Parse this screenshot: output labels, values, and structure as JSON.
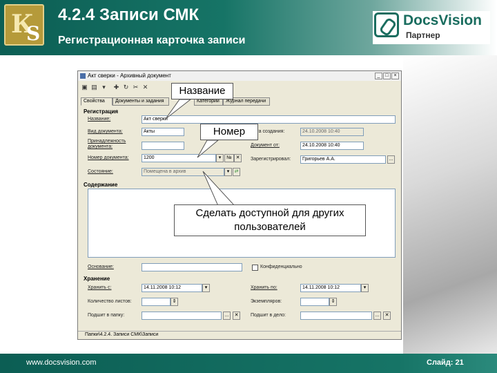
{
  "slide": {
    "title": "4.2.4  Записи СМК",
    "subtitle": "Регистрационная карточка записи",
    "brand_name": "DocsVision",
    "brand_sub": "Партнер",
    "footer_url": "www.docsvision.com",
    "slide_number": "Слайд: 21"
  },
  "window": {
    "title": "Акт сверки - Архивный документ",
    "tabs": [
      "Свойства",
      "Документы и задания",
      "Категории",
      "Журнал передачи"
    ],
    "sections": {
      "registration": "Регистрация",
      "content": "Содержание",
      "storage": "Хранение"
    },
    "fields": {
      "name_label": "Название:",
      "name_value": "Акт сверки",
      "doc_type_label": "Вид документа:",
      "doc_type_value": "Акты",
      "belongs_label": "Принадлежность документа:",
      "reg_number_label": "Номер документа:",
      "reg_number_value": "1200",
      "number_btn": "№",
      "state_label": "Состояние:",
      "state_value": "Помещена в архив",
      "date_created_label": "Дата создания:",
      "date_created_value": "24.10.2008 10:40",
      "doc_from_label": "Документ от:",
      "doc_from_value": "24.10.2008 10:40",
      "registrar_label": "Зарегистрировал:",
      "registrar_value": "Григорьев А.А.",
      "basis_label": "Основание:",
      "confidential_label": "Конфиденциально",
      "store_from_label": "Хранить с:",
      "store_from_value": "14.11.2008 10:12",
      "store_to_label": "Хранить по:",
      "store_to_value": "14.11.2008 10:12",
      "sheets_label": "Количество листов:",
      "copies_label": "Экземпляров:",
      "folder_label": "Подшит в папку:",
      "case_label": "Подшит в дело:",
      "browse": "..."
    },
    "status_path": "Папки\\4.2.4. Записи СМК\\Записи"
  },
  "callouts": {
    "name": "Название",
    "number": "Номер",
    "share": "Сделать доступной для других пользователей"
  }
}
